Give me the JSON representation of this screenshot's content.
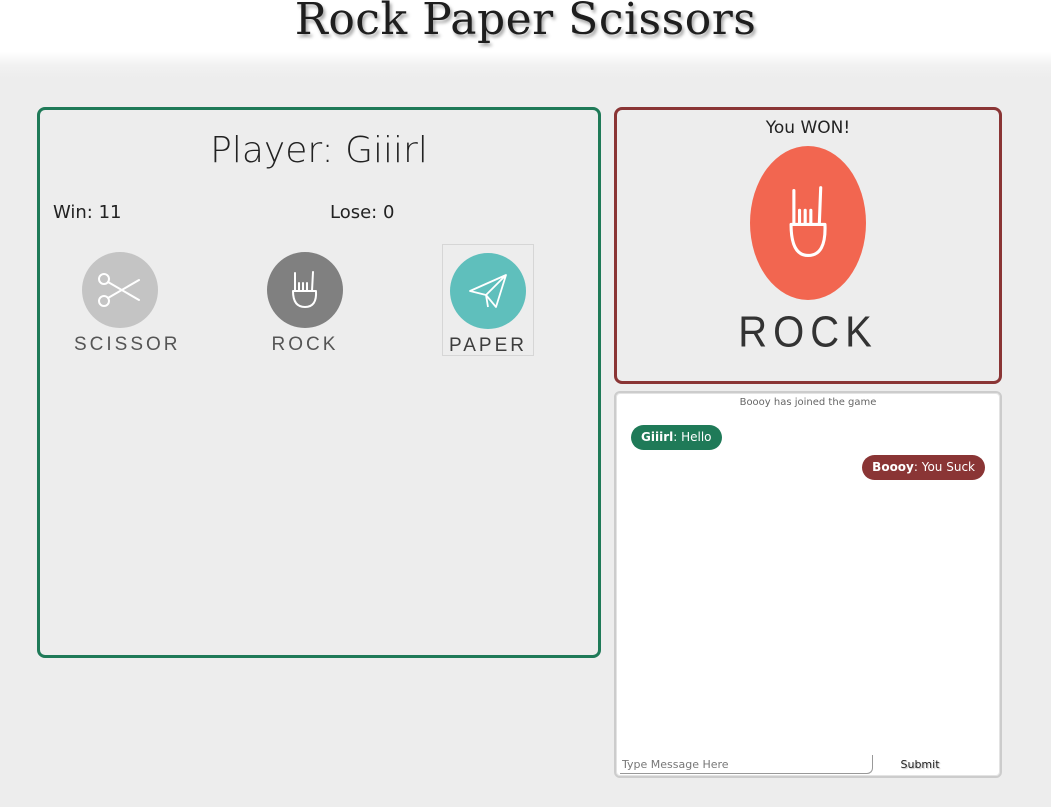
{
  "header": {
    "title": "Rock Paper Scissors"
  },
  "player": {
    "name_label": "Player: Giiirl",
    "win_label": "Win: 11",
    "lose_label": "Lose: 0"
  },
  "choices": [
    {
      "label": "SCISSOR",
      "icon": "scissors-icon",
      "color": "#c4c4c4"
    },
    {
      "label": "ROCK",
      "icon": "rock-hand-icon",
      "color": "#808080"
    },
    {
      "label": "PAPER",
      "icon": "paper-plane-icon",
      "color": "#5fbfbc"
    }
  ],
  "result": {
    "text": "You WON!",
    "choice_label": "ROCK",
    "choice_icon": "rock-hand-icon",
    "color": "#f26650"
  },
  "chat": {
    "notice": "Boooy has joined the game",
    "messages": [
      {
        "author": "Giiirl",
        "text": ": Hello",
        "color": "#1f7a58"
      },
      {
        "author": "Boooy",
        "text": ": You Suck",
        "color": "#8a3535"
      }
    ],
    "input_placeholder": "Type Message Here",
    "submit_label": "Submit"
  },
  "colors": {
    "player_border": "#1f7a58",
    "result_border": "#8a3535",
    "background": "#ededed"
  }
}
